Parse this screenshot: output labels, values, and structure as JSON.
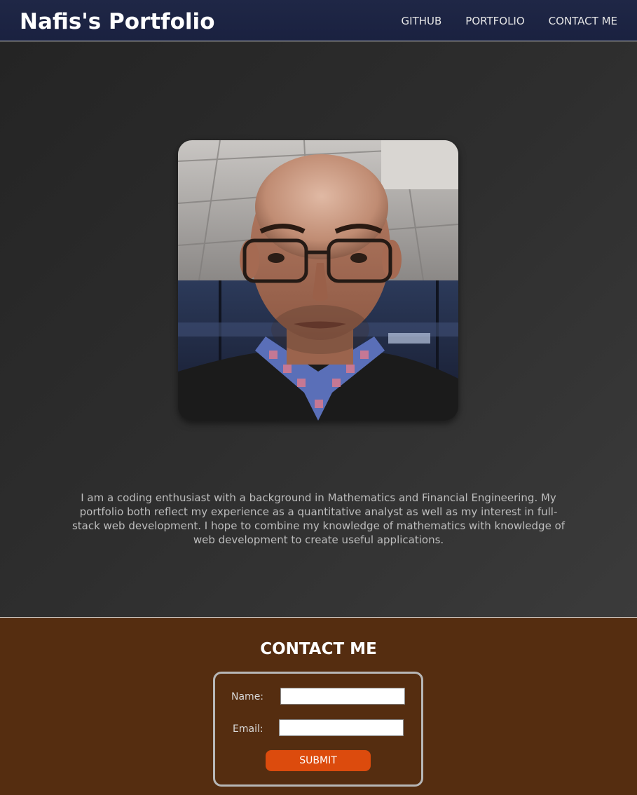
{
  "navbar": {
    "brand": "Nafis's Portfolio",
    "links": [
      "GITHUB",
      "PORTFOLIO",
      "CONTACT ME"
    ]
  },
  "hero": {
    "photo_alt": "Profile photo",
    "bio": "I am a coding enthusiast with a background in Mathematics and Financial Engineering. My portfolio both reflect my experience as a quantitative analyst as well as my interest in full-stack web development. I hope to combine my knowledge of mathematics with knowledge of web development to create useful applications."
  },
  "contact": {
    "title": "CONTACT ME",
    "name_label": "Name:",
    "name_value": "",
    "email_label": "Email:",
    "email_value": "",
    "submit_label": "SUBMIT"
  },
  "colors": {
    "navbar_bg": "#1f2746",
    "contact_bg": "#552d10",
    "accent_button": "#dc4b0d"
  }
}
